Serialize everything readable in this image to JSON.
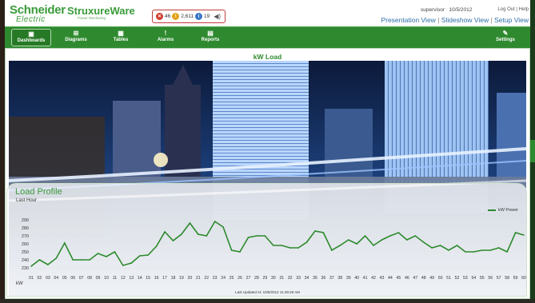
{
  "header": {
    "logo": "Schneider",
    "logo_sub": "Electric",
    "product": "StruxureWare",
    "product_sub": "Power Monitoring",
    "alarms": {
      "red": "46",
      "amber": "2,611",
      "blue": "19"
    },
    "user": "supervisor",
    "date": "10/5/2012",
    "logout": "Log Out",
    "help": "Help",
    "views": [
      "Presentation View",
      "Slideshow View",
      "Setup View"
    ]
  },
  "nav": {
    "items": [
      {
        "label": "Dashboards",
        "icon": "dashboards-icon"
      },
      {
        "label": "Diagrams",
        "icon": "diagrams-icon"
      },
      {
        "label": "Tables",
        "icon": "tables-icon"
      },
      {
        "label": "Alarms",
        "icon": "alarms-icon"
      },
      {
        "label": "Reports",
        "icon": "reports-icon"
      }
    ],
    "settings": "Settings"
  },
  "dashboard": {
    "title": "kW Load"
  },
  "panel": {
    "title": "Load Profile",
    "subtitle": "Last Hour",
    "updated": "Last Updated At: 10/5/2012 11:49:29 AM"
  },
  "chart_data": {
    "type": "line",
    "title": "Load Profile",
    "subtitle": "Last Hour",
    "xlabel": "",
    "ylabel": "kW",
    "ylim": [
      225,
      295
    ],
    "yticks": [
      230,
      240,
      250,
      260,
      270,
      280,
      290
    ],
    "legend_position": "top-right",
    "categories": [
      "01",
      "02",
      "03",
      "04",
      "05",
      "06",
      "07",
      "08",
      "09",
      "10",
      "11",
      "12",
      "13",
      "14",
      "15",
      "16",
      "17",
      "18",
      "19",
      "20",
      "21",
      "22",
      "23",
      "24",
      "25",
      "26",
      "27",
      "28",
      "29",
      "30",
      "31",
      "32",
      "33",
      "34",
      "35",
      "36",
      "37",
      "38",
      "39",
      "40",
      "41",
      "42",
      "43",
      "44",
      "45",
      "46",
      "47",
      "48",
      "49",
      "50",
      "51",
      "52",
      "53",
      "54",
      "55",
      "56",
      "57",
      "58",
      "59",
      "60"
    ],
    "series": [
      {
        "name": "kW Power",
        "color": "#2c8a2c",
        "values": [
          232,
          240,
          234,
          242,
          261,
          240,
          240,
          240,
          248,
          244,
          250,
          233,
          236,
          245,
          246,
          257,
          275,
          264,
          272,
          286,
          272,
          270,
          288,
          281,
          252,
          250,
          268,
          270,
          270,
          258,
          258,
          255,
          255,
          262,
          276,
          274,
          252,
          258,
          265,
          260,
          270,
          258,
          265,
          270,
          274,
          265,
          270,
          262,
          255,
          258,
          252,
          258,
          250,
          250,
          252,
          252,
          255,
          250,
          274,
          271
        ]
      }
    ]
  }
}
